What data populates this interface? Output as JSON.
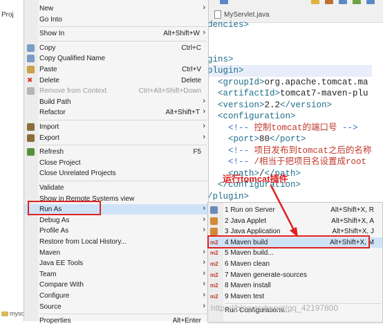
{
  "explorer": {
    "title": "Proj",
    "rows": [
      "mysql",
      "m"
    ]
  },
  "editor": {
    "tab_label": "MyServlet.java",
    "lines": [
      {
        "kind": "tag",
        "text": "dencies>"
      },
      {
        "kind": "blank",
        "text": ""
      },
      {
        "kind": "blank",
        "text": ""
      },
      {
        "kind": "tag",
        "text": "gins>"
      },
      {
        "kind": "tag",
        "text": "plugin>"
      },
      {
        "kind": "mixed",
        "parts": [
          [
            "tag",
            "  <groupId>"
          ],
          [
            "txt",
            "org.apache.tomcat.ma"
          ]
        ]
      },
      {
        "kind": "mixed",
        "parts": [
          [
            "tag",
            "  <artifactId>"
          ],
          [
            "txt",
            "tomcat7-maven-plu"
          ]
        ]
      },
      {
        "kind": "mixed",
        "parts": [
          [
            "tag",
            "  <version>"
          ],
          [
            "txt",
            "2.2"
          ],
          [
            "tag",
            "</version>"
          ]
        ]
      },
      {
        "kind": "tag",
        "text": "  <configuration>"
      },
      {
        "kind": "mixed",
        "parts": [
          [
            "cmt",
            "    <!-- "
          ],
          [
            "cmt-red",
            "控制tomcat的端口号"
          ],
          [
            "cmt",
            " -->"
          ]
        ]
      },
      {
        "kind": "mixed",
        "parts": [
          [
            "tag",
            "    <port>"
          ],
          [
            "txt",
            "80"
          ],
          [
            "tag",
            "</port>"
          ]
        ]
      },
      {
        "kind": "mixed",
        "parts": [
          [
            "cmt",
            "    <!-- "
          ],
          [
            "cmt-red",
            "项目发布到tomcat之后的名称"
          ]
        ]
      },
      {
        "kind": "mixed",
        "parts": [
          [
            "cmt",
            "    <!-- "
          ],
          [
            "cmt-red",
            "/相当于把项目名设置成root"
          ]
        ]
      },
      {
        "kind": "mixed",
        "parts": [
          [
            "tag",
            "    <path>"
          ],
          [
            "txt",
            "/"
          ],
          [
            "tag",
            "</path>"
          ]
        ]
      },
      {
        "kind": "tag",
        "text": "  </configuration>"
      },
      {
        "kind": "tag",
        "text": "/plugin>"
      },
      {
        "kind": "tag",
        "text": "lugins>"
      }
    ]
  },
  "menu": {
    "items": [
      {
        "label": "New",
        "shortcut": "",
        "arrow": true,
        "icon": "",
        "disabled": false
      },
      {
        "label": "Go Into",
        "shortcut": "",
        "arrow": false,
        "icon": "",
        "disabled": false
      },
      {
        "sep": true
      },
      {
        "label": "Show In",
        "shortcut": "Alt+Shift+W",
        "arrow": true,
        "icon": "",
        "disabled": false
      },
      {
        "sep": true
      },
      {
        "label": "Copy",
        "shortcut": "Ctrl+C",
        "arrow": false,
        "icon": "copy-icon",
        "disabled": false
      },
      {
        "label": "Copy Qualified Name",
        "shortcut": "",
        "arrow": false,
        "icon": "copy-icon",
        "disabled": false
      },
      {
        "label": "Paste",
        "shortcut": "Ctrl+V",
        "arrow": false,
        "icon": "paste-icon",
        "disabled": false
      },
      {
        "label": "Delete",
        "shortcut": "Delete",
        "arrow": false,
        "icon": "delete-icon",
        "disabled": false
      },
      {
        "label": "Remove from Context",
        "shortcut": "Ctrl+Alt+Shift+Down",
        "arrow": false,
        "icon": "remove-context-icon",
        "disabled": true
      },
      {
        "label": "Build Path",
        "shortcut": "",
        "arrow": true,
        "icon": "",
        "disabled": false
      },
      {
        "label": "Refactor",
        "shortcut": "Alt+Shift+T",
        "arrow": true,
        "icon": "",
        "disabled": false
      },
      {
        "sep": true
      },
      {
        "label": "Import",
        "shortcut": "",
        "arrow": true,
        "icon": "import-icon",
        "disabled": false
      },
      {
        "label": "Export",
        "shortcut": "",
        "arrow": true,
        "icon": "export-icon",
        "disabled": false
      },
      {
        "sep": true
      },
      {
        "label": "Refresh",
        "shortcut": "F5",
        "arrow": false,
        "icon": "refresh-icon",
        "disabled": false
      },
      {
        "label": "Close Project",
        "shortcut": "",
        "arrow": false,
        "icon": "",
        "disabled": false
      },
      {
        "label": "Close Unrelated Projects",
        "shortcut": "",
        "arrow": false,
        "icon": "",
        "disabled": false
      },
      {
        "sep": true
      },
      {
        "label": "Validate",
        "shortcut": "",
        "arrow": false,
        "icon": "",
        "disabled": false
      },
      {
        "label": "Show in Remote Systems view",
        "shortcut": "",
        "arrow": false,
        "icon": "",
        "disabled": false
      },
      {
        "label": "Run As",
        "shortcut": "",
        "arrow": true,
        "icon": "",
        "disabled": false,
        "selected": true
      },
      {
        "label": "Debug As",
        "shortcut": "",
        "arrow": true,
        "icon": "",
        "disabled": false
      },
      {
        "label": "Profile As",
        "shortcut": "",
        "arrow": true,
        "icon": "",
        "disabled": false
      },
      {
        "label": "Restore from Local History...",
        "shortcut": "",
        "arrow": false,
        "icon": "",
        "disabled": false
      },
      {
        "label": "Maven",
        "shortcut": "",
        "arrow": true,
        "icon": "",
        "disabled": false
      },
      {
        "label": "Java EE Tools",
        "shortcut": "",
        "arrow": true,
        "icon": "",
        "disabled": false
      },
      {
        "label": "Team",
        "shortcut": "",
        "arrow": true,
        "icon": "",
        "disabled": false
      },
      {
        "label": "Compare With",
        "shortcut": "",
        "arrow": true,
        "icon": "",
        "disabled": false
      },
      {
        "label": "Configure",
        "shortcut": "",
        "arrow": true,
        "icon": "",
        "disabled": false
      },
      {
        "label": "Source",
        "shortcut": "",
        "arrow": true,
        "icon": "",
        "disabled": false
      },
      {
        "sep": true
      },
      {
        "label": "Properties",
        "shortcut": "Alt+Enter",
        "arrow": false,
        "icon": "",
        "disabled": false
      }
    ]
  },
  "submenu": {
    "items": [
      {
        "label": "1 Run on Server",
        "shortcut": "Alt+Shift+X, R",
        "icon": "run-server-icon",
        "badge": ""
      },
      {
        "label": "2 Java Applet",
        "shortcut": "Alt+Shift+X, A",
        "icon": "java-applet-icon",
        "badge": ""
      },
      {
        "label": "3 Java Application",
        "shortcut": "Alt+Shift+X, J",
        "icon": "java-app-icon",
        "badge": ""
      },
      {
        "label": "4 Maven build",
        "shortcut": "Alt+Shift+X, M",
        "icon": "maven-icon",
        "badge": "m2",
        "selected": true
      },
      {
        "label": "5 Maven build...",
        "shortcut": "",
        "icon": "maven-icon",
        "badge": "m2"
      },
      {
        "label": "6 Maven clean",
        "shortcut": "",
        "icon": "maven-icon",
        "badge": "m2"
      },
      {
        "label": "7 Maven generate-sources",
        "shortcut": "",
        "icon": "maven-icon",
        "badge": "m2"
      },
      {
        "label": "8 Maven install",
        "shortcut": "",
        "icon": "maven-icon",
        "badge": "m2"
      },
      {
        "label": "9 Maven test",
        "shortcut": "",
        "icon": "maven-icon",
        "badge": "m2"
      },
      {
        "sep": true
      },
      {
        "label": "Run Configurations...",
        "shortcut": "",
        "icon": "",
        "badge": ""
      }
    ]
  },
  "annotation": {
    "callout": "运行tomcat插件",
    "color": "#e02020"
  },
  "watermark": "https://blog.csdn.net/qq_42197800"
}
